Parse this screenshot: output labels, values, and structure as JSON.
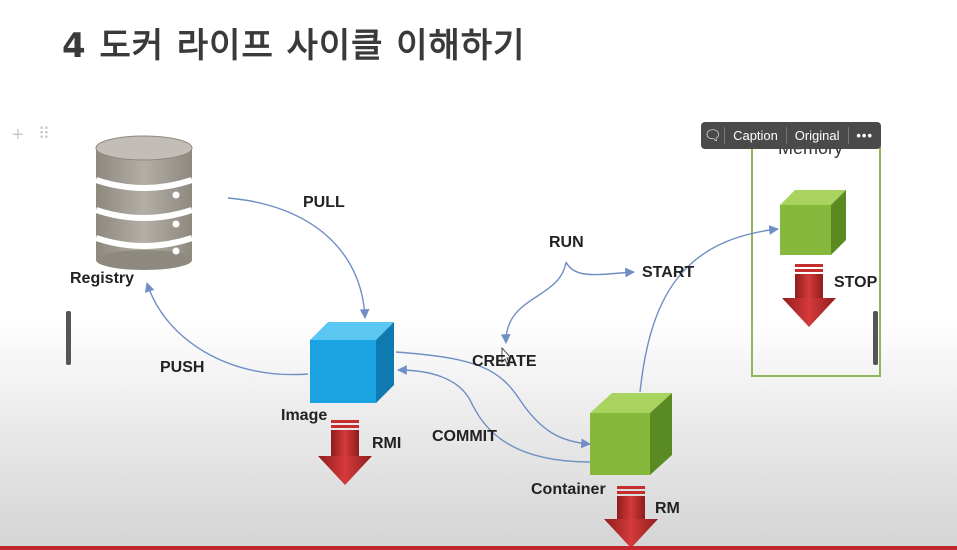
{
  "slide": {
    "title": "4 도커 라이프 사이클 이해하기"
  },
  "toolbar": {
    "caption_label": "Caption",
    "original_label": "Original",
    "more_label": "•••"
  },
  "diagram": {
    "nodes": {
      "registry": "Registry",
      "image": "Image",
      "container": "Container",
      "memory": "Memory"
    },
    "edges": {
      "pull": "PULL",
      "push": "PUSH",
      "run": "RUN",
      "start": "START",
      "create": "CREATE",
      "commit": "COMMIT",
      "rmi": "RMI",
      "rm": "RM",
      "stop": "STOP"
    }
  },
  "colors": {
    "registry": "#a9a49c",
    "image": "#1aa2e2",
    "container": "#86b83c",
    "arrow_line": "#6f8fc4",
    "delete_arrow": "#c62d2d",
    "memory_border": "#8db85a"
  }
}
